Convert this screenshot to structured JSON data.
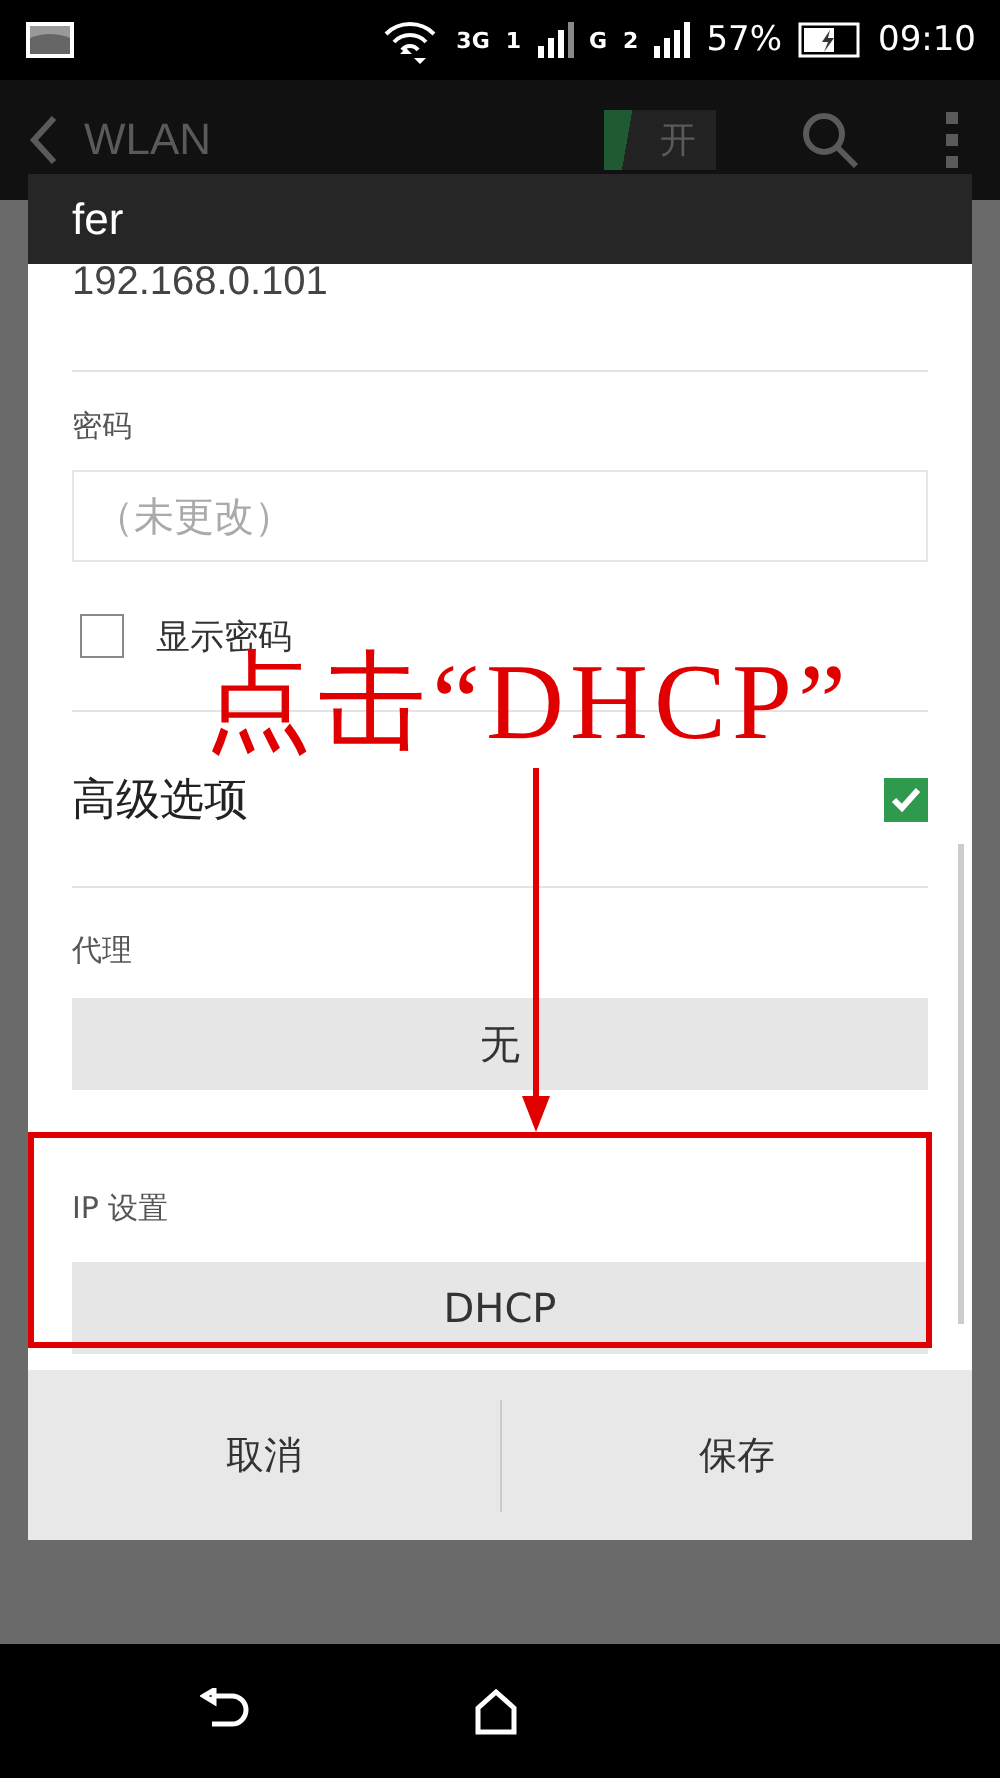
{
  "status_bar": {
    "network": "3G",
    "sim1": "1",
    "sim2_type": "G",
    "sim2": "2",
    "battery": "57%",
    "time": "09:10"
  },
  "action_bar": {
    "title": "WLAN",
    "toggle": {
      "label": "开",
      "on": true
    }
  },
  "dialog": {
    "title": "fer",
    "ip_address": "192.168.0.101",
    "password": {
      "label": "密码",
      "placeholder": "（未更改）"
    },
    "show_password": {
      "label": "显示密码",
      "checked": false
    },
    "advanced": {
      "label": "高级选项",
      "checked": true
    },
    "proxy": {
      "label": "代理",
      "value": "无"
    },
    "ip_settings": {
      "label": "IP 设置",
      "value": "DHCP"
    },
    "buttons": [
      "取消",
      "保存"
    ]
  },
  "annotation": {
    "text": "点击“DHCP”"
  }
}
